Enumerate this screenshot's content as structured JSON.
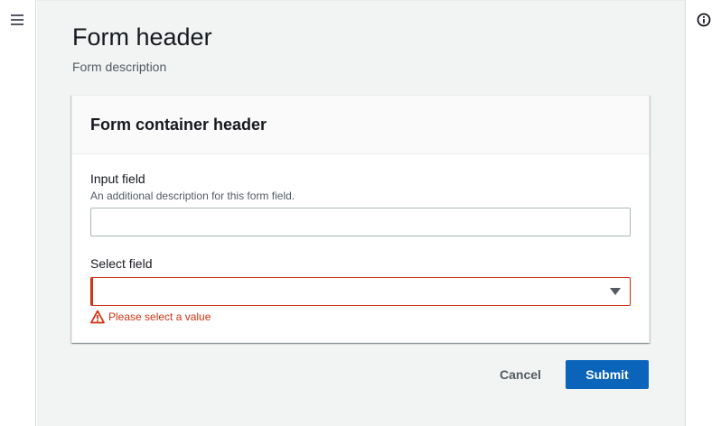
{
  "page": {
    "title": "Form header",
    "description": "Form description"
  },
  "container": {
    "title": "Form container header"
  },
  "input_field": {
    "label": "Input field",
    "description": "An additional description for this form field.",
    "value": ""
  },
  "select_field": {
    "label": "Select field",
    "selected_value": "",
    "error": "Please select a value"
  },
  "actions": {
    "cancel_label": "Cancel",
    "submit_label": "Submit"
  },
  "icons": {
    "menu": "hamburger-menu-icon",
    "info": "info-icon",
    "caret": "caret-down-icon",
    "warning": "warning-icon"
  },
  "colors": {
    "accent": "#0a64b9",
    "error": "#d13212",
    "background": "#f2f3f3"
  }
}
